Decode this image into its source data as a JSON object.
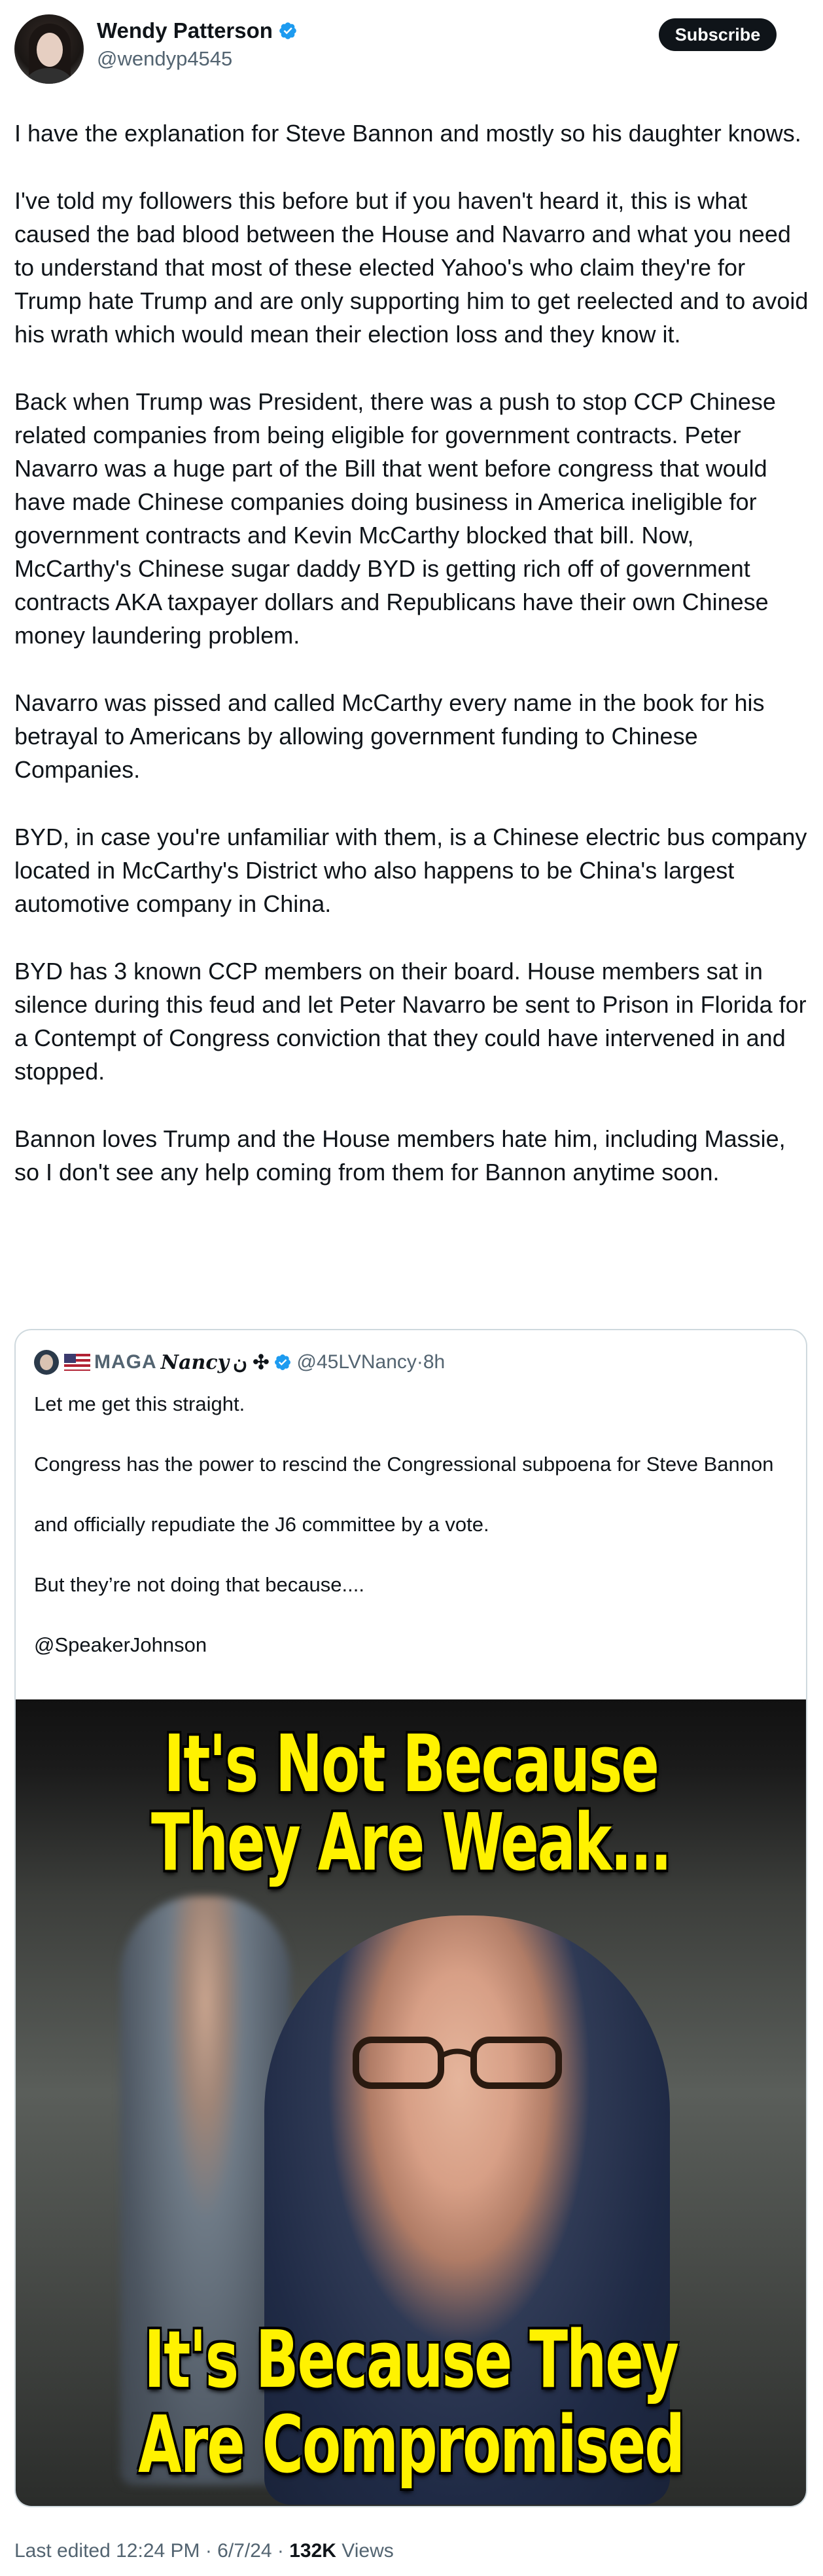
{
  "author": {
    "name": "Wendy Patterson",
    "handle": "@wendyp4545",
    "verified": true
  },
  "subscribe_label": "Subscribe",
  "post_paragraphs": [
    "I have the explanation for Steve Bannon and mostly so his daughter knows.",
    "I've told my followers this before but if you haven't heard it, this is what caused the bad blood between the House and Navarro and what you need to understand that most of these elected Yahoo's who claim they're for Trump hate Trump and are only supporting him to get reelected and to avoid his wrath which would mean their election loss and they know it.",
    "Back when Trump was President, there was a push to stop CCP Chinese related companies from being eligible for government contracts. Peter Navarro was a huge part of the Bill that went before congress that would have made Chinese companies doing business in America ineligible for government contracts and Kevin McCarthy blocked that bill.  Now, McCarthy's Chinese sugar daddy BYD is getting rich off of government contracts AKA taxpayer dollars and Republicans have their own Chinese money laundering problem.",
    "Navarro was pissed and called McCarthy every name in the book for his betrayal to Americans by allowing government funding to Chinese Companies.",
    "BYD, in case you're unfamiliar with them, is a Chinese electric bus company located in McCarthy's District who also happens to be China's largest automotive company in China.",
    "BYD has 3 known CCP members on their board. House members sat in silence during this feud and let Peter Navarro be sent to Prison in Florida for a Contempt of Congress conviction that they could have intervened in and stopped.",
    "Bannon loves Trump and the House members hate him, including Massie, so I don't see any help coming from them for Bannon anytime soon."
  ],
  "quoted_post": {
    "name_prefix": "MAGA",
    "name_main": "Nancy",
    "name_suffix": "ن ✣",
    "handle": "@45LVNancy",
    "separator": "·",
    "time": "8h",
    "paragraphs": [
      "Let me get this straight.",
      "Congress has the power to rescind the Congressional subpoena for Steve Bannon",
      "and officially repudiate the J6 committee by a vote.",
      "But they’re not doing that because....",
      "@SpeakerJohnson"
    ],
    "image_text": {
      "top_line1": "It's Not Because",
      "top_line2": "They Are Weak...",
      "bottom_line1": "It's Because They",
      "bottom_line2": "Are Compromised"
    }
  },
  "footer": {
    "edited": "Last edited 12:24 PM · 6/7/24 · ",
    "views_count": "132K",
    "views_label": " Views"
  },
  "colors": {
    "verified_blue": "#1d9bf0",
    "meme_yellow": "#fff200",
    "secondary_text": "#536471"
  }
}
